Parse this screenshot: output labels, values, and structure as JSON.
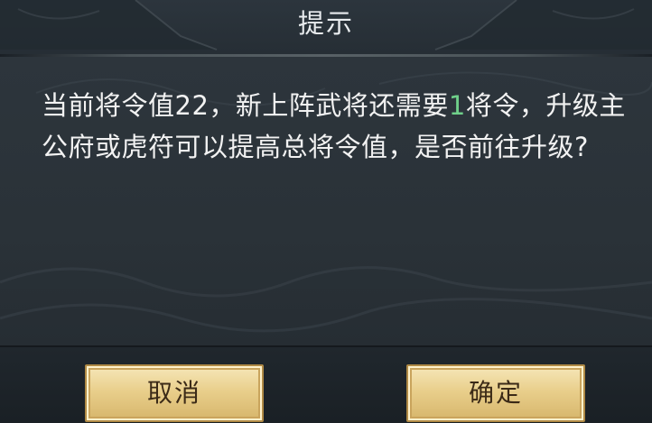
{
  "dialog": {
    "title": "提示",
    "message": {
      "before": "当前将令值22，新上阵武将还需要",
      "highlight": "1",
      "after": "将令，升级主公府或虎符可以提高总将令值，是否前往升级?"
    },
    "cancel_label": "取消",
    "confirm_label": "确定"
  },
  "colors": {
    "background": "#1f262c",
    "text": "#f2f2f2",
    "highlight": "#6fd08a",
    "button_gold": "#e9cf8c",
    "button_text": "#3b2a17"
  }
}
